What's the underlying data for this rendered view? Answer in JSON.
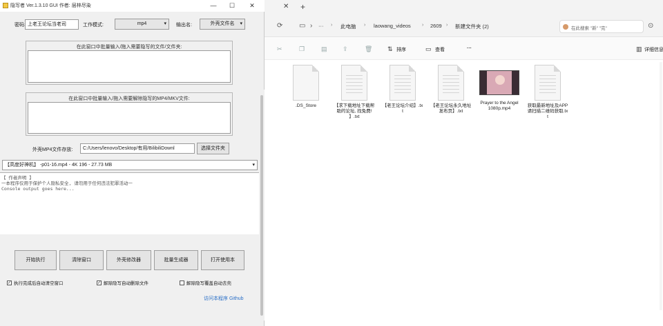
{
  "app": {
    "title": "隐写者 Ver.1.3.10 GUI 作者: 层林尽染",
    "win_minimize": "—",
    "win_maximize": "☐",
    "win_close": "✕",
    "password_label": "密码:",
    "password_value": "上老王论坛当老司",
    "mode_label": "工作模式:",
    "mode_value": "mp4",
    "output_label": "输出名:",
    "output_value": "外壳文件名",
    "dropdown_arrow": "▾",
    "hide_group_title": "在此窗口中批量输入/拖入需要隐写的文件/文件夹:",
    "reveal_group_title": "在此窗口中批量输入/拖入需要解除隐写的MP4/MKV文件:",
    "shell_label": "外壳MP4文件存放:",
    "shell_path": "C:/Users/lenovo/Desktop/有用/BilibiliDownl",
    "choose_file_button": "选择文件夹",
    "shell_select_value": "【高度好神机】 -p01-16.mp4 - 4K 196 - 27.73 MB",
    "console_lines": [
      "【 作者声明 】",
      "一本程序仅用于保护个人隐私安全, 请勿用于任何违法犯罪活动一",
      "Console output goes here..."
    ],
    "buttons": [
      "开始执行",
      "清除窗口",
      "外壳修改器",
      "批量生成器",
      "打开使用本"
    ],
    "checkboxes": [
      {
        "label": "执行完成后自动清空窗口",
        "checked": true
      },
      {
        "label": "解除隐写自动删除文件",
        "checked": true
      },
      {
        "label": "解除隐写覆盖自动去壳",
        "checked": false
      }
    ],
    "github_link": "访问本程序 Github"
  },
  "explorer": {
    "tab_close": "✕",
    "tab_add": "+",
    "breadcrumbs": [
      "此电脑",
      "laowang_videos",
      "2609",
      "新建文件夹 (2)"
    ],
    "more_crumbs": "···",
    "search_text": "在此搜索 \"新\"  \"完\"",
    "sort_label": "排序",
    "view_label": "查看",
    "more_label": "···",
    "details_label": "详细信息",
    "files": [
      {
        "name": ".DS_Store",
        "kind": "blank"
      },
      {
        "name": "【求下载地址下载帮助的论坛, 找免费! 】.txt",
        "kind": "text"
      },
      {
        "name": "【老王论坛介绍】.txt",
        "kind": "text"
      },
      {
        "name": "【老王论坛永久地址发布页】.txt",
        "kind": "text"
      },
      {
        "name": "Prayer to the Angel 1080p.mp4",
        "kind": "video"
      },
      {
        "name": "获取最新地址及APP请扫描二维码获取.txt",
        "kind": "text"
      }
    ]
  }
}
